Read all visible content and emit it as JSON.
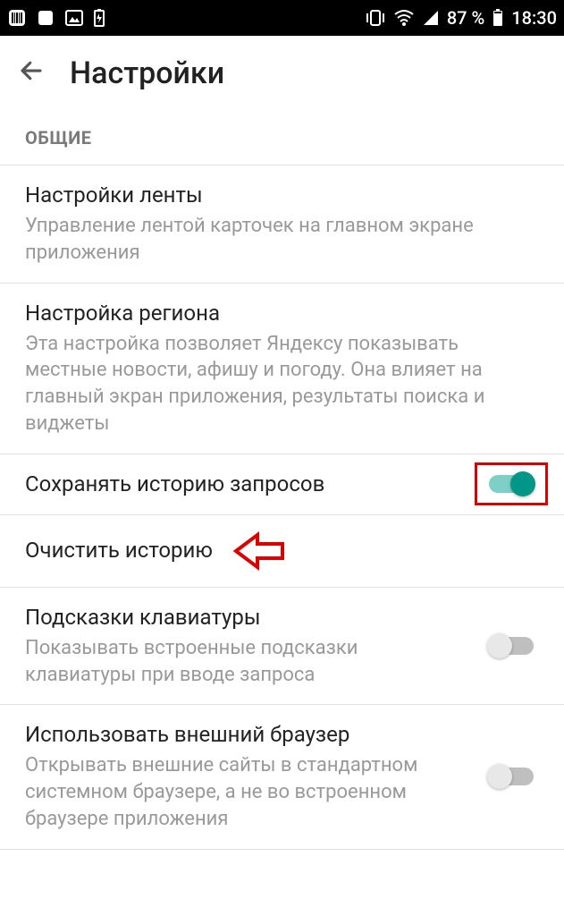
{
  "status_bar": {
    "battery_percent": "87 %",
    "time": "18:30"
  },
  "header": {
    "title": "Настройки"
  },
  "section": {
    "general": "ОБЩИЕ"
  },
  "settings": {
    "feed": {
      "title": "Настройки ленты",
      "description": "Управление лентой карточек на главном экране приложения"
    },
    "region": {
      "title": "Настройка региона",
      "description": "Эта настройка позволяет Яндексу показывать местные новости, афишу и погоду. Она влияет на главный экран приложения, результаты поиска и виджеты"
    },
    "save_history": {
      "title": "Сохранять историю запросов",
      "toggle": true
    },
    "clear_history": {
      "title": "Очистить историю"
    },
    "keyboard_hints": {
      "title": "Подсказки клавиатуры",
      "description": "Показывать встроенные подсказки клавиатуры при вводе запроса",
      "toggle": false
    },
    "external_browser": {
      "title": "Использовать внешний браузер",
      "description": "Открывать внешние сайты в стандартном системном браузере, а не во встроенном браузере приложения",
      "toggle": false
    }
  },
  "colors": {
    "toggle_on": "#019688",
    "annotation": "#d90000"
  }
}
